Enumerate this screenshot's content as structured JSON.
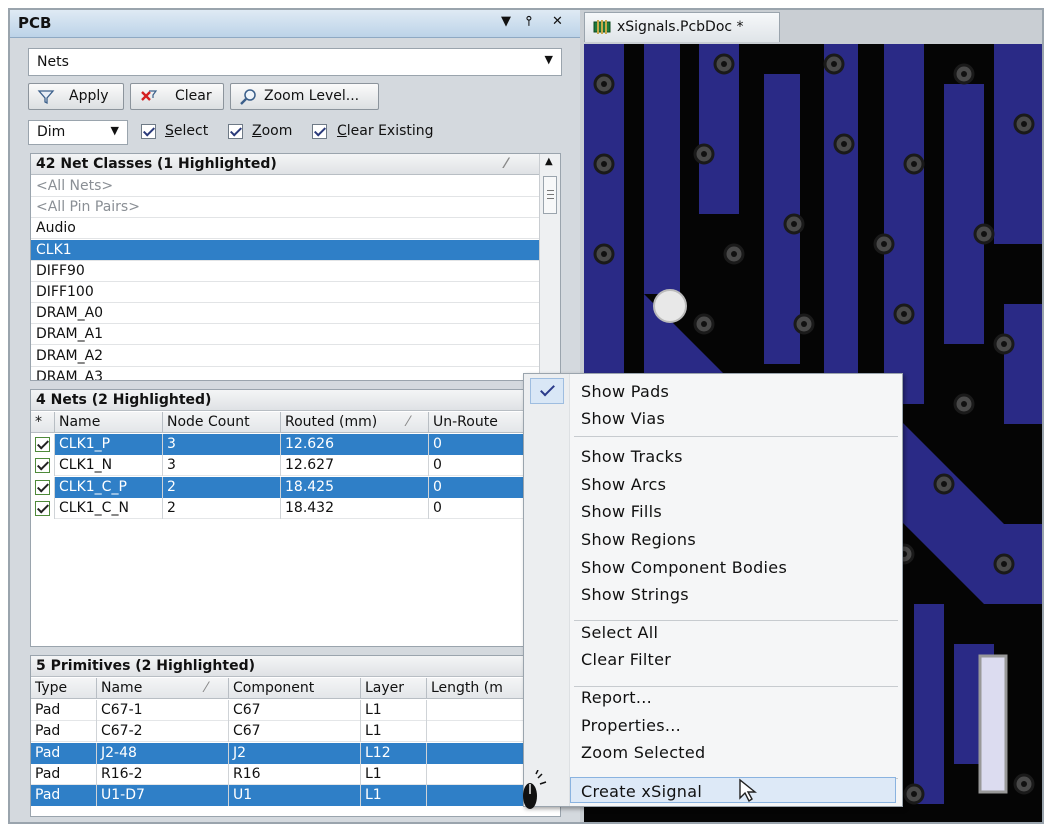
{
  "panel": {
    "title": "PCB",
    "controls": [
      "▼",
      "⫯",
      "✕"
    ],
    "mode_select": "Nets",
    "buttons": {
      "apply": "Apply",
      "clear": "Clear",
      "zoom_level": "Zoom Level..."
    },
    "dim_select": "Dim",
    "checks": {
      "select": "Select",
      "zoom": "Zoom",
      "clear_existing": "Clear Existing"
    }
  },
  "net_classes": {
    "header": "42 Net Classes (1 Highlighted)",
    "items": [
      {
        "label": "<All Nets>",
        "style": "gray"
      },
      {
        "label": "<All Pin Pairs>",
        "style": "gray"
      },
      {
        "label": "Audio",
        "style": "normal"
      },
      {
        "label": "CLK1",
        "style": "selected"
      },
      {
        "label": "DIFF90",
        "style": "normal"
      },
      {
        "label": "DIFF100",
        "style": "normal"
      },
      {
        "label": "DRAM_A0",
        "style": "normal"
      },
      {
        "label": "DRAM_A1",
        "style": "normal"
      },
      {
        "label": "DRAM_A2",
        "style": "normal"
      },
      {
        "label": "DRAM_A3",
        "style": "normal"
      }
    ]
  },
  "nets": {
    "header": "4 Nets (2 Highlighted)",
    "columns": [
      "*",
      "Name",
      "Node Count",
      "Routed (mm)",
      "Un-Route"
    ],
    "rows": [
      {
        "name": "CLK1_P",
        "nodes": "3",
        "routed": "12.626",
        "unrouted": "0",
        "selected": true
      },
      {
        "name": "CLK1_N",
        "nodes": "3",
        "routed": "12.627",
        "unrouted": "0",
        "selected": false
      },
      {
        "name": "CLK1_C_P",
        "nodes": "2",
        "routed": "18.425",
        "unrouted": "0",
        "selected": true
      },
      {
        "name": "CLK1_C_N",
        "nodes": "2",
        "routed": "18.432",
        "unrouted": "0",
        "selected": false
      }
    ]
  },
  "primitives": {
    "header": "5 Primitives (2 Highlighted)",
    "columns": [
      "Type",
      "Name",
      "Component",
      "Layer",
      "Length (m"
    ],
    "rows": [
      {
        "type": "Pad",
        "name": "C67-1",
        "component": "C67",
        "layer": "L1",
        "selected": false
      },
      {
        "type": "Pad",
        "name": "C67-2",
        "component": "C67",
        "layer": "L1",
        "selected": false
      },
      {
        "type": "Pad",
        "name": "J2-48",
        "component": "J2",
        "layer": "L12",
        "selected": true
      },
      {
        "type": "Pad",
        "name": "R16-2",
        "component": "R16",
        "layer": "L1",
        "selected": false
      },
      {
        "type": "Pad",
        "name": "U1-D7",
        "component": "U1",
        "layer": "L1",
        "selected": true
      }
    ]
  },
  "document": {
    "tab_label": "xSignals.PcbDoc *"
  },
  "context_menu": {
    "items": [
      {
        "label": "Show Pads",
        "checked": true
      },
      {
        "label": "Show Vias"
      },
      {
        "label": "Show Tracks"
      },
      {
        "label": "Show Arcs"
      },
      {
        "label": "Show Fills"
      },
      {
        "label": "Show Regions"
      },
      {
        "label": "Show Component Bodies"
      },
      {
        "label": "Show Strings"
      },
      {
        "label": "Select All"
      },
      {
        "label": "Clear Filter"
      },
      {
        "label": "Report..."
      },
      {
        "label": "Properties..."
      },
      {
        "label": "Zoom Selected"
      },
      {
        "label": "Create xSignal",
        "highlighted": true
      }
    ]
  },
  "colors": {
    "selection": "#2f7fc7",
    "board_trace": "#2a2a86",
    "board_background": "#050505"
  }
}
